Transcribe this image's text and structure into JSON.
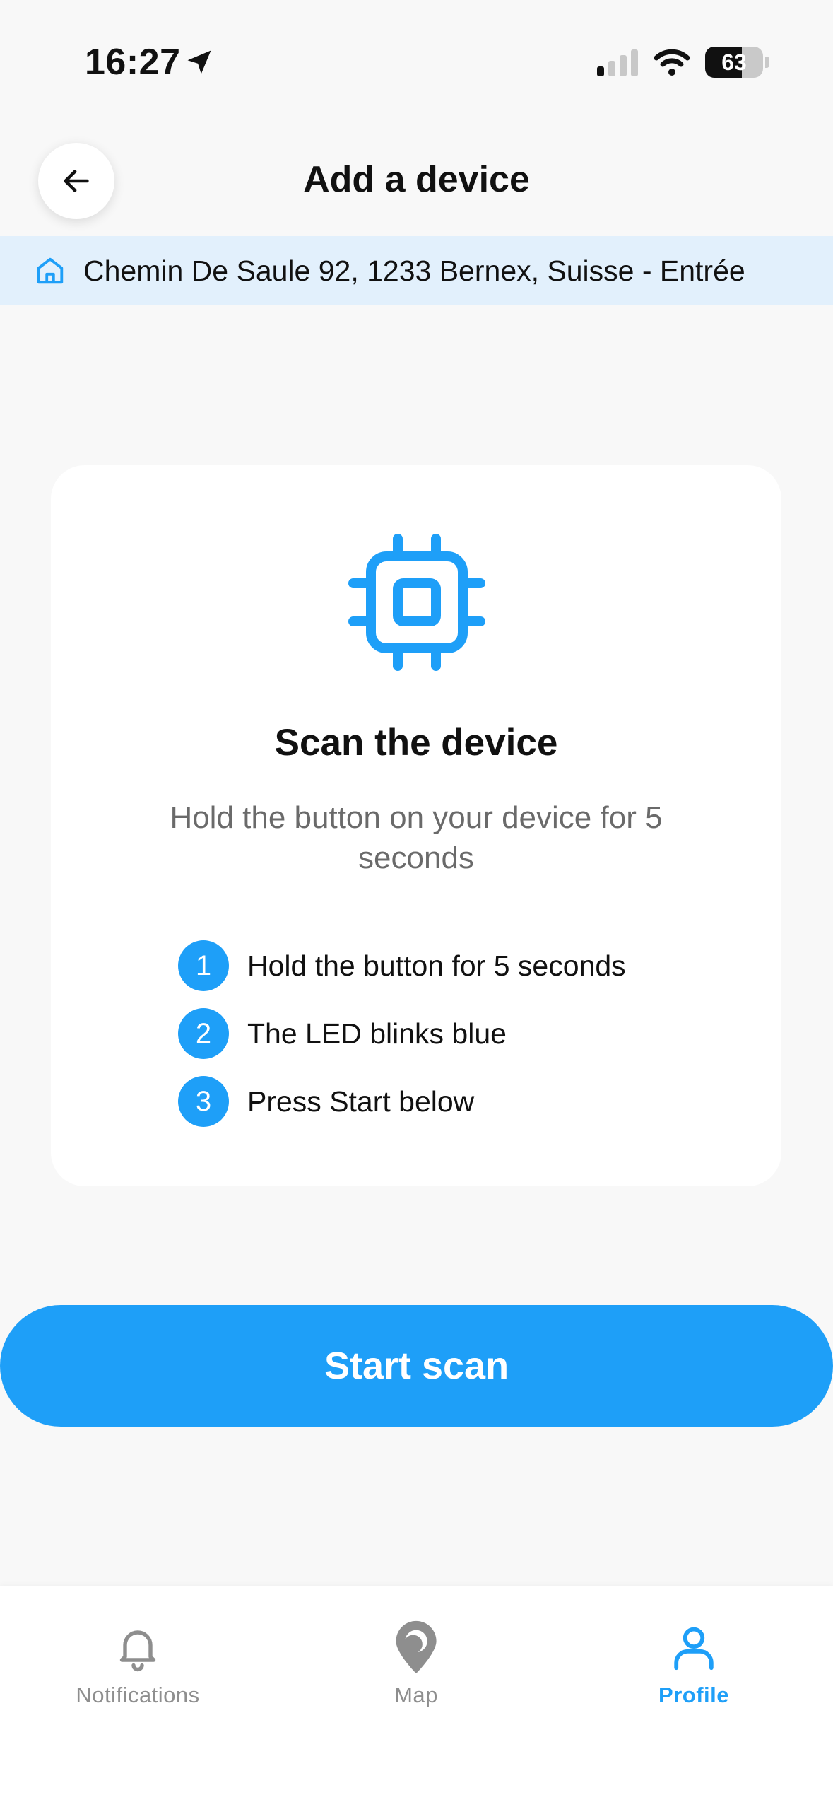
{
  "status_bar": {
    "time": "16:27",
    "battery": "63",
    "battery_level": 0.63
  },
  "header": {
    "title": "Add a device",
    "back_icon": "arrow-left-icon"
  },
  "address": {
    "icon": "home-icon",
    "text": "Chemin De Saule 92, 1233 Bernex, Suisse - Entrée"
  },
  "card": {
    "icon": "chip-icon",
    "title": "Scan the device",
    "subtitle": "Hold the button on your device for 5 seconds",
    "steps": [
      {
        "number": "1",
        "text": "Hold the button for 5 seconds"
      },
      {
        "number": "2",
        "text": "The LED blinks blue"
      },
      {
        "number": "3",
        "text": "Press Start below"
      }
    ]
  },
  "actions": {
    "start_label": "Start scan"
  },
  "tab_bar": {
    "items": [
      {
        "label": "Notifications",
        "icon": "bell-icon",
        "active": false
      },
      {
        "label": "Map",
        "icon": "map-pin-icon",
        "active": false
      },
      {
        "label": "Profile",
        "icon": "user-icon",
        "active": true
      }
    ]
  },
  "colors": {
    "accent": "#1e9ff8",
    "address_bg": "#e2f0fc",
    "inactive": "#8e8e8e"
  }
}
